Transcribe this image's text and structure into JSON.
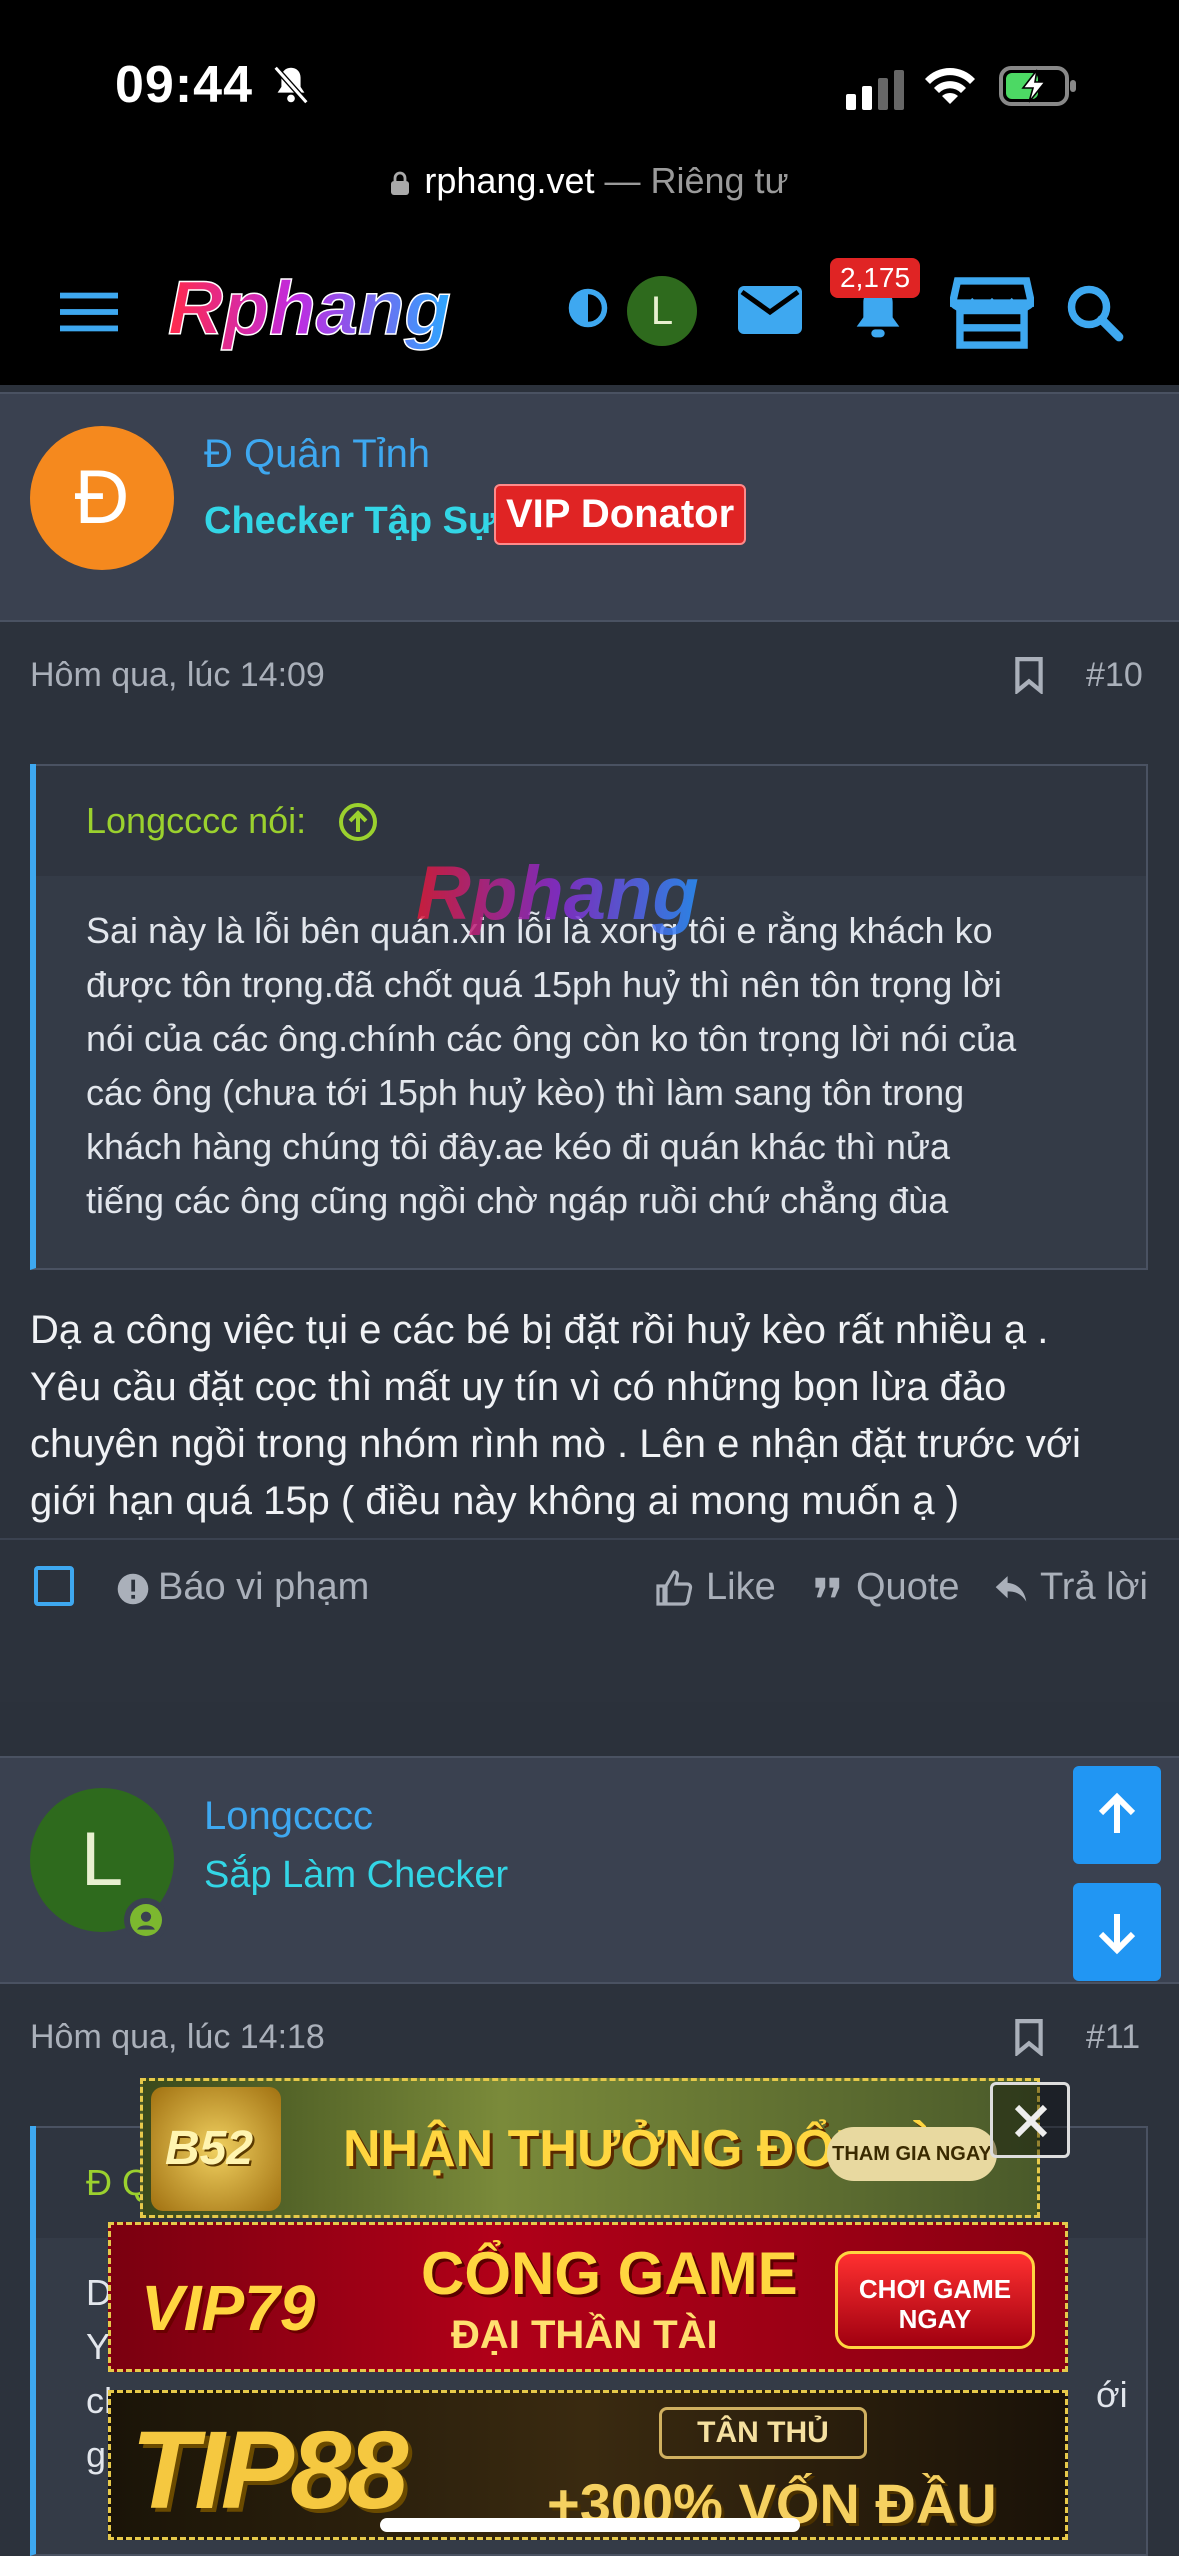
{
  "status": {
    "time": "09:44"
  },
  "browser": {
    "domain": "rphang.vet",
    "privacy": "— Riêng tư"
  },
  "header": {
    "logo_text": "Rphang",
    "avatar_letter": "L",
    "notif_count": "2,175"
  },
  "posts": [
    {
      "author": "Đ Quân Tỉnh",
      "avatar_letter": "Đ",
      "title": "Checker Tập Sự",
      "vip": "VIP Donator",
      "date": "Hôm qua, lúc 14:09",
      "num": "#10",
      "quote_author": "Longcccc nói:",
      "quote_lines": [
        "Sai này là lỗi bên quán.xin lỗi là xong tôi e rằng khách ko",
        "được tôn trọng.đã chốt quá 15ph huỷ thì nên tôn trọng lời",
        "nói của các ông.chính các ông còn ko tôn trọng lời nói của",
        "các ông (chưa tới 15ph huỷ kèo) thì làm sang tôn trong",
        "khách hàng chúng tôi đây.ae kéo đi quán khác thì nửa",
        "tiếng các ông cũng ngồi chờ ngáp ruồi chứ chẳng đùa"
      ],
      "body_lines": [
        "Dạ a công việc tụi e các bé bị đặt rồi huỷ kèo rất nhiều ạ .",
        "Yêu cầu đặt cọc thì mất uy tín vì có những bọn lừa đảo",
        "chuyên ngồi trong nhóm rình mò . Lên e nhận đặt trước với",
        "giới hạn quá 15p ( điều này không ai mong muốn ạ )"
      ],
      "actions": {
        "report": "Báo vi phạm",
        "like": "Like",
        "quote": "Quote",
        "reply": "Trả lời"
      }
    },
    {
      "author": "Longcccc",
      "avatar_letter": "L",
      "title": "Sắp Làm Checker",
      "date": "Hôm qua, lúc 14:18",
      "num": "#11",
      "quote_author_partial": "Đ Q",
      "partial_lines": [
        "D",
        "Y",
        "ch",
        "gi"
      ],
      "partial_right": "ới"
    }
  ],
  "ads": [
    {
      "brand": "B52",
      "headline": "NHẬN THƯỞNG ĐỔI ĐỜI",
      "cta": "THAM GIA NGAY"
    },
    {
      "brand": "VIP79",
      "headline": "CỔNG GAME",
      "sub": "ĐẠI THẦN TÀI",
      "cta": "CHƠI GAME NGAY"
    },
    {
      "brand": "TIP88",
      "tag": "TÂN THỦ",
      "headline": "+300% VỐN ĐẦU"
    }
  ],
  "colors": {
    "accent": "#3ea8f0",
    "vip_red": "#e02424",
    "quote_green": "#9bd12e",
    "bg": "#2c323c"
  }
}
